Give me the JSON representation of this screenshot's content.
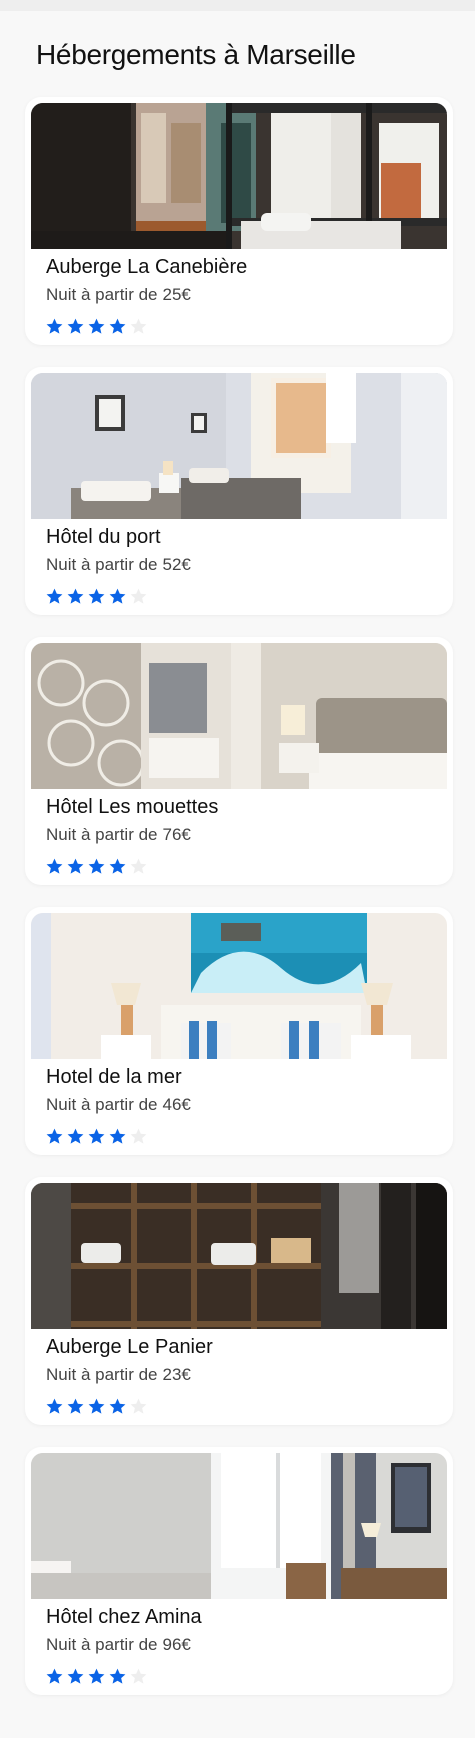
{
  "title": "Hébergements à Marseille",
  "price_label": "Nuit à partir de",
  "colors": {
    "star_filled": "#0a63e6",
    "star_empty": "#eeeeee"
  },
  "stars_max": 5,
  "hotels": [
    {
      "name": "Auberge La Canebière",
      "price": "25€",
      "rating": 4
    },
    {
      "name": "Hôtel du port",
      "price": "52€",
      "rating": 4
    },
    {
      "name": "Hôtel Les mouettes",
      "price": "76€",
      "rating": 4
    },
    {
      "name": "Hotel de la mer",
      "price": "46€",
      "rating": 4
    },
    {
      "name": "Auberge Le Panier",
      "price": "23€",
      "rating": 4
    },
    {
      "name": "Hôtel chez Amina",
      "price": "96€",
      "rating": 4
    }
  ]
}
